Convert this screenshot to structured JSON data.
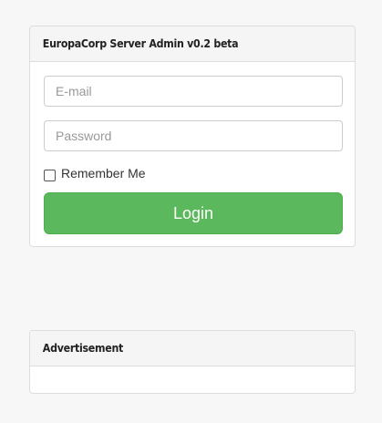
{
  "login_panel": {
    "title": "EuropaCorp Server Admin v0.2 beta",
    "email_placeholder": "E-mail",
    "password_placeholder": "Password",
    "remember_label": "Remember Me",
    "login_label": "Login"
  },
  "ad_panel": {
    "title": "Advertisement"
  },
  "colors": {
    "login_button": "#5cb85c",
    "background": "#f7f7f7"
  }
}
